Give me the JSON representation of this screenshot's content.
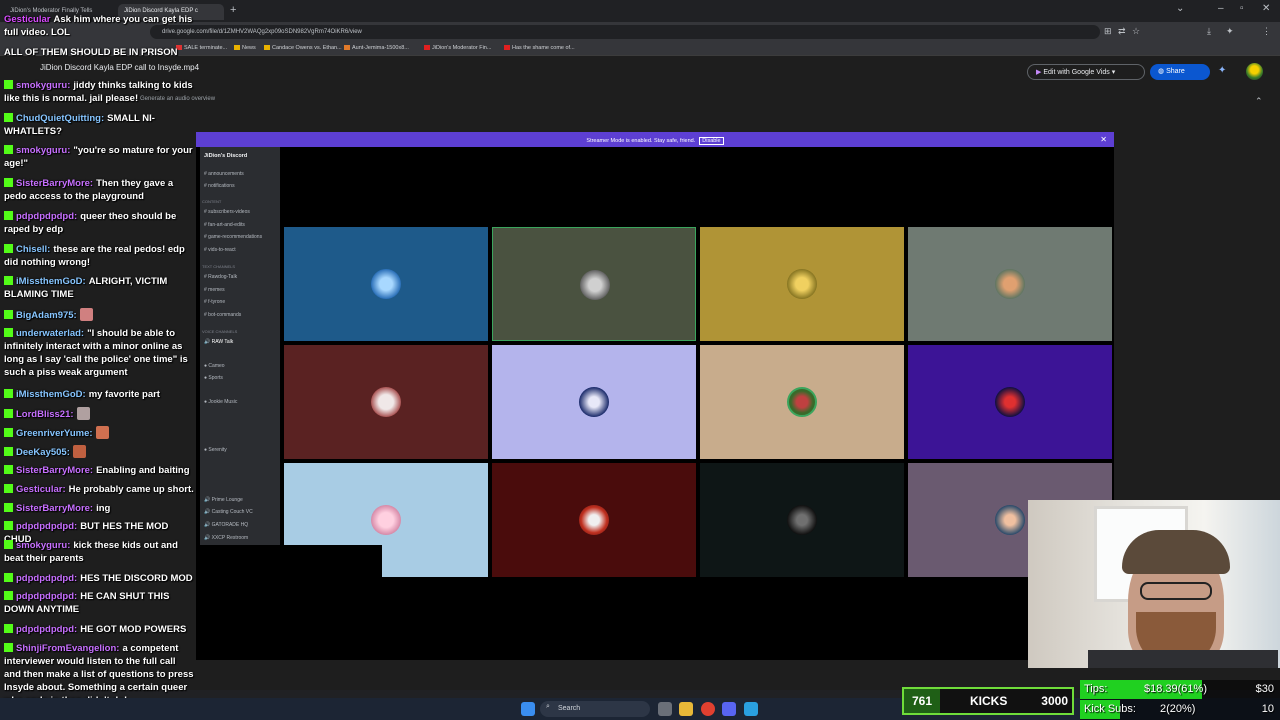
{
  "browser": {
    "tabs": [
      {
        "label": "JiDion's Moderator Finally Tells"
      },
      {
        "label": "JiDion Discord Kayla EDP c"
      }
    ],
    "new_tab": "+",
    "url": "drive.google.com/file/d/1ZMHV2WAQg2xp09oSDN982VgRm74OiKR6/view",
    "bookmarks": [
      {
        "label": "SALE terminate..."
      },
      {
        "label": "News"
      },
      {
        "label": "Candace Owens vs. Ethan..."
      },
      {
        "label": "Aunt-Jemima-1500x8..."
      },
      {
        "label": "JiDion's Moderator Fin..."
      },
      {
        "label": "Has the shame come of..."
      }
    ]
  },
  "drive": {
    "file_title": "JiDion Discord Kayla EDP call to Insyde.mp4",
    "audio_overview": "Generate an audio overview",
    "edit_vids": "Edit with Google Vids",
    "share": "Share"
  },
  "discord": {
    "streamer_banner": "Streamer Mode is enabled. Stay safe, friend.",
    "disable": "Disable",
    "server_name": "JiDion's Discord",
    "channels": [
      "announcements",
      "notifications",
      "subscribers-videos",
      "fan-art-and-edits",
      "game-recommendations",
      "vids-to-react",
      "Rawdog-Talk",
      "memes",
      "f-tyrone",
      "bot-commands",
      "RAW Talk",
      "Cameo",
      "Sports",
      "Jookie Music",
      "Serenity",
      "Prime Lounge",
      "Casting Couch VC",
      "GATORADE HQ",
      "XXCP Restroom"
    ],
    "categories": [
      "content",
      "text channels",
      "voice channels"
    ]
  },
  "chat": {
    "messages": [
      {
        "user": "Gesticular",
        "text": "Ask him where you can get his full video. LOL",
        "user_color": "#d94cff"
      },
      {
        "user": "",
        "text": "ALL OF THEM SHOULD BE IN PRISON",
        "user_color": "#ffffff"
      },
      {
        "user": "smokyguru:",
        "text": "jiddy thinks talking to kids like this is normal. jail please!",
        "user_color": "#c770ff"
      },
      {
        "user": "ChudQuietQuitting:",
        "text": "SMALL NI-WHATLETS?",
        "user_color": "#86c5ff"
      },
      {
        "user": "smokyguru:",
        "text": "\"you're so mature for your age!\"",
        "user_color": "#c770ff"
      },
      {
        "user": "SisterBarryMore:",
        "text": "Then they gave a pedo access to the playground",
        "user_color": "#c770ff"
      },
      {
        "user": "pdpdpdpdpd:",
        "text": "queer theo should be raped by edp",
        "user_color": "#c770ff"
      },
      {
        "user": "Chisell:",
        "text": "these are the real pedos! edp did nothing wrong!",
        "user_color": "#86c5ff"
      },
      {
        "user": "iMissthemGoD:",
        "text": "ALRIGHT, VICTIM BLAMING TIME",
        "user_color": "#86c5ff"
      },
      {
        "user": "BigAdam975:",
        "text": "",
        "user_color": "#86c5ff"
      },
      {
        "user": "underwaterlad:",
        "text": "\"I should be able to infinitely interact with a minor online as long as I say 'call the police' one time\" is such a piss weak argument",
        "user_color": "#86c5ff"
      },
      {
        "user": "iMissthemGoD:",
        "text": "my favorite part",
        "user_color": "#86c5ff"
      },
      {
        "user": "LordBliss21:",
        "text": "",
        "user_color": "#c770ff"
      },
      {
        "user": "GreenriverYume:",
        "text": "",
        "user_color": "#86c5ff"
      },
      {
        "user": "DeeKay505:",
        "text": "",
        "user_color": "#86c5ff"
      },
      {
        "user": "SisterBarryMore:",
        "text": "Enabling and baiting",
        "user_color": "#c770ff"
      },
      {
        "user": "Gesticular:",
        "text": "He probably came up short.",
        "user_color": "#c770ff"
      },
      {
        "user": "SisterBarryMore:",
        "text": "ing",
        "user_color": "#c770ff"
      },
      {
        "user": "pdpdpdpdpd:",
        "text": "BUT HES THE MOD CHUD",
        "user_color": "#c770ff"
      },
      {
        "user": "smokyguru:",
        "text": "kick these kids out and beat their parents",
        "user_color": "#c770ff"
      },
      {
        "user": "pdpdpdpdpd:",
        "text": "HES THE DISCORD MOD",
        "user_color": "#c770ff"
      },
      {
        "user": "pdpdpdpdpd:",
        "text": "HE CAN SHUT THIS DOWN ANYTIME",
        "user_color": "#c770ff"
      },
      {
        "user": "pdpdpdpdpd:",
        "text": "HE GOT MOD POWERS",
        "user_color": "#c770ff"
      },
      {
        "user": "ShinjiFromEvangelion:",
        "text": "a competent interviewer would listen to the full call and then make a list of questions to press Insyde about. Something a certain queer who ends in theo didn't do!",
        "user_color": "#c770ff"
      }
    ]
  },
  "taskbar": {
    "search_label": "Search"
  },
  "widgets": {
    "kicks_current": "761",
    "kicks_label": "KICKS",
    "kicks_goal": "3000",
    "tips_label": "Tips:",
    "tips_value": "$18.39(61%)",
    "tips_goal": "$30",
    "tips_progress": 0.61,
    "subs_label": "Kick Subs:",
    "subs_value": "2(20%)",
    "subs_goal": "10",
    "subs_progress": 0.2
  },
  "colors": {
    "kick_green": "#53fc18",
    "streamer_purple": "#5d3fd3",
    "share_blue": "#0b57d0"
  }
}
